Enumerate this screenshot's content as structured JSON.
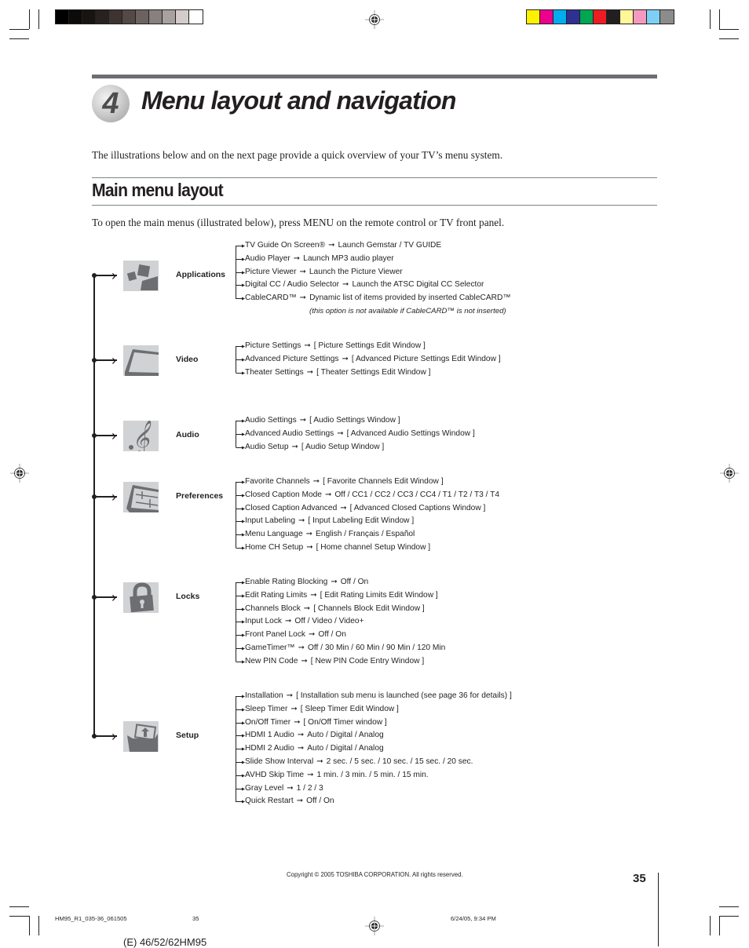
{
  "print_marks": {
    "gray_bars": [
      "#000000",
      "#0d0b0a",
      "#181412",
      "#272220",
      "#3d3432",
      "#544946",
      "#6c6361",
      "#88807e",
      "#a8a1a0",
      "#d3cccb",
      "#ffffff"
    ],
    "color_bars": [
      "#fff200",
      "#ec008c",
      "#00aeef",
      "#2e3192",
      "#00a651",
      "#ed1c24",
      "#231f20",
      "#fff799",
      "#f49ac1",
      "#7dd0f4",
      "#8c8c8c"
    ]
  },
  "chapter": {
    "number": "4",
    "title": "Menu layout and navigation"
  },
  "intro_text": "The illustrations below and on the next page provide a quick overview of your TV’s menu system.",
  "section": {
    "title": "Main menu layout",
    "instruction": "To open the main menus (illustrated below), press MENU on the remote control or TV front panel."
  },
  "menus": [
    {
      "label": "Applications",
      "icon": "applications-icon",
      "items": [
        {
          "name": "TV Guide On Screen®",
          "value": "Launch Gemstar / TV GUIDE"
        },
        {
          "name": "Audio Player",
          "value": "Launch MP3 audio player"
        },
        {
          "name": "Picture Viewer",
          "value": "Launch the Picture Viewer"
        },
        {
          "name": "Digital CC / Audio Selector",
          "value": "Launch the ATSC Digital CC Selector"
        },
        {
          "name": "CableCARD™",
          "value": "Dynamic list of items provided by inserted CableCARD™"
        }
      ],
      "note": "(this option is not available if CableCARD™ is not inserted)"
    },
    {
      "label": "Video",
      "icon": "video-icon",
      "items": [
        {
          "name": "Picture Settings",
          "value": "[ Picture Settings Edit Window ]"
        },
        {
          "name": "Advanced Picture Settings",
          "value": "[ Advanced Picture Settings Edit Window ]"
        },
        {
          "name": "Theater Settings",
          "value": "[ Theater Settings Edit Window ]"
        }
      ]
    },
    {
      "label": "Audio",
      "icon": "audio-icon",
      "items": [
        {
          "name": "Audio Settings",
          "value": "[ Audio Settings Window ]"
        },
        {
          "name": "Advanced Audio Settings",
          "value": "[ Advanced Audio Settings Window ]"
        },
        {
          "name": "Audio Setup",
          "value": "[ Audio Setup Window ]"
        }
      ]
    },
    {
      "label": "Preferences",
      "icon": "preferences-icon",
      "items": [
        {
          "name": "Favorite Channels",
          "value": "[ Favorite Channels Edit Window ]"
        },
        {
          "name": "Closed Caption Mode",
          "value": "Off / CC1 / CC2 / CC3 / CC4 / T1 / T2 / T3 / T4"
        },
        {
          "name": "Closed Caption Advanced",
          "value": "[ Advanced Closed Captions Window ]"
        },
        {
          "name": "Input Labeling",
          "value": "[ Input Labeling Edit Window ]"
        },
        {
          "name": "Menu Language",
          "value": "English / Français / Español"
        },
        {
          "name": "Home CH Setup",
          "value": "[ Home channel Setup Window ]"
        }
      ]
    },
    {
      "label": "Locks",
      "icon": "lock-icon",
      "items": [
        {
          "name": "Enable Rating Blocking",
          "value": "Off / On"
        },
        {
          "name": "Edit Rating Limits",
          "value": "[ Edit Rating Limits Edit Window ]"
        },
        {
          "name": "Channels Block",
          "value": "[ Channels Block Edit Window ]"
        },
        {
          "name": "Input Lock",
          "value": "Off / Video / Video+"
        },
        {
          "name": "Front Panel Lock",
          "value": "Off / On"
        },
        {
          "name": "GameTimer™",
          "value": "Off / 30 Min / 60 Min / 90 Min / 120 Min"
        },
        {
          "name": "New PIN Code",
          "value": "[ New PIN Code Entry Window ]"
        }
      ]
    },
    {
      "label": "Setup",
      "icon": "setup-icon",
      "items": [
        {
          "name": "Installation",
          "value": "[ Installation sub menu is launched (see page 36 for details) ]"
        },
        {
          "name": "Sleep Timer",
          "value": "[ Sleep Timer Edit Window ]"
        },
        {
          "name": "On/Off Timer",
          "value": "[ On/Off Timer window ]"
        },
        {
          "name": "HDMI 1 Audio",
          "value": "Auto / Digital / Analog"
        },
        {
          "name": "HDMI 2 Audio",
          "value": "Auto / Digital / Analog"
        },
        {
          "name": "Slide Show Interval",
          "value": "2 sec. / 5 sec. / 10 sec. / 15 sec. / 20 sec."
        },
        {
          "name": "AVHD Skip Time",
          "value": "1 min. / 3 min. / 5 min. / 15 min."
        },
        {
          "name": "Gray Level",
          "value": "1 / 2 / 3"
        },
        {
          "name": "Quick Restart",
          "value": "Off / On"
        }
      ]
    }
  ],
  "arrow_glyph": "➞",
  "footer": {
    "copyright": "Copyright © 2005 TOSHIBA CORPORATION. All rights reserved.",
    "page_number": "35",
    "file_name": "HM95_R1_035-36_061505",
    "slug_page": "35",
    "date_time": "6/24/05, 9:34 PM",
    "model": "(E) 46/52/62HM95"
  }
}
